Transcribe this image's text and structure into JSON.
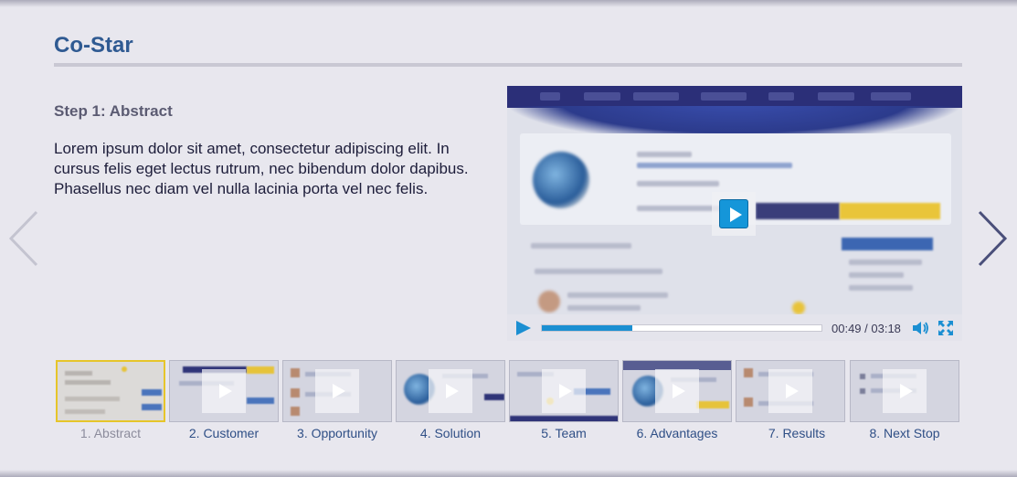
{
  "page": {
    "title": "Co-Star"
  },
  "step": {
    "heading": "Step 1: Abstract",
    "body": "Lorem ipsum dolor sit amet, consectetur adipiscing elit. In cursus felis eget lectus rutrum, nec bibendum dolor dapibus. Phasellus nec diam vel nulla lacinia porta vel nec felis."
  },
  "navigation": {
    "prev_icon": "chevron-left-icon",
    "next_icon": "chevron-right-icon"
  },
  "video": {
    "time_display": "00:49 / 03:18",
    "progress": 0.325,
    "play_icon": "play-icon",
    "volume_icon": "volume-icon",
    "fullscreen_icon": "fullscreen-icon"
  },
  "thumbnails": [
    {
      "label": "1. Abstract",
      "active": true
    },
    {
      "label": "2. Customer",
      "active": false
    },
    {
      "label": "3. Opportunity",
      "active": false
    },
    {
      "label": "4. Solution",
      "active": false
    },
    {
      "label": "5. Team",
      "active": false
    },
    {
      "label": "6. Advantages",
      "active": false
    },
    {
      "label": "7. Results",
      "active": false
    },
    {
      "label": "8. Next Stop",
      "active": false
    }
  ],
  "colors": {
    "background": "#e8e7ee",
    "title": "#2f5a92",
    "accent": "#1b8fd2",
    "active_thumb_border": "#e6c52a",
    "label_link": "#2f4f86"
  }
}
